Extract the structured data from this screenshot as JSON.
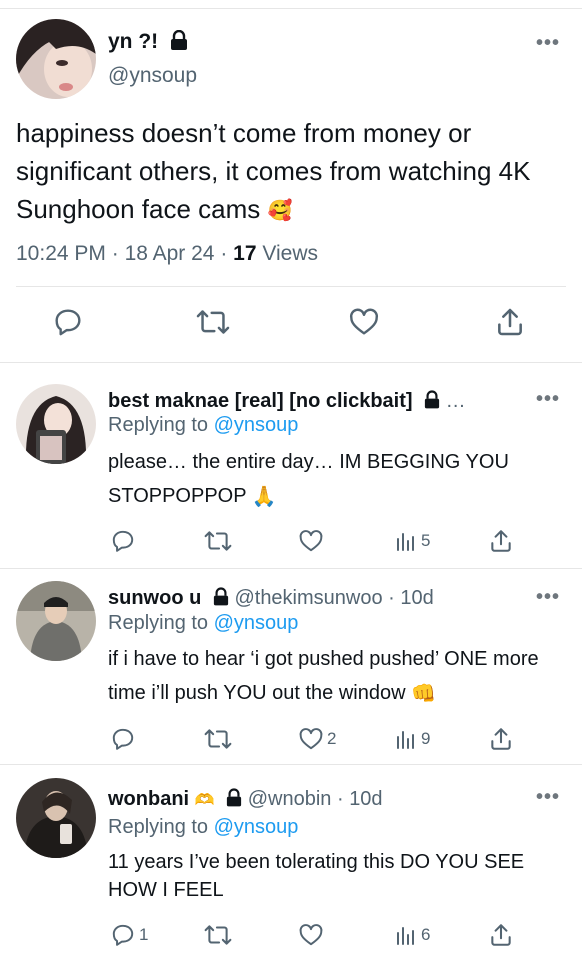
{
  "main_tweet": {
    "display_name": "yn ?!",
    "handle": "@ynsoup",
    "text": "happiness doesn’t come from money or significant others, it comes from watching 4K Sunghoon face cams",
    "emoji": "🥰",
    "time": "10:24 PM",
    "date": "18 Apr 24",
    "views_count": "17",
    "views_label": "Views",
    "more": "•••"
  },
  "replies": [
    {
      "display_name": "best maknae [real] [no clickbait]",
      "handle": "",
      "age": "",
      "replying_prefix": "Replying to",
      "replying_to": "@ynsoup",
      "text": "please… the entire day… IM BEGGING YOU STOPPOPPOP",
      "emoji": "🙏",
      "reply_count": "",
      "like_count": "",
      "views": "5",
      "more": "•••"
    },
    {
      "display_name": "sunwoo u",
      "handle": "@thekimsunwoo",
      "age": "10d",
      "replying_prefix": "Replying to",
      "replying_to": "@ynsoup",
      "text": "if i have to hear ‘i got pushed pushed’ ONE more time i’ll push YOU out the window",
      "emoji": "👊",
      "reply_count": "",
      "like_count": "2",
      "views": "9",
      "more": "•••"
    },
    {
      "display_name": "wonbani",
      "name_emoji": "🫶",
      "handle": "@wnobin",
      "age": "10d",
      "replying_prefix": "Replying to",
      "replying_to": "@ynsoup",
      "text": "11 years I’ve been tolerating this DO YOU SEE HOW I FEEL",
      "emoji": "",
      "reply_count": "1",
      "like_count": "",
      "views": "6",
      "more": "•••"
    }
  ],
  "icons": [
    "reply-icon",
    "retweet-icon",
    "like-icon",
    "views-icon",
    "share-icon",
    "lock-icon",
    "more-icon"
  ],
  "colors": {
    "text": "#0f1419",
    "secondary": "#536471",
    "link": "#1d9bf0",
    "divider": "#e6e6e6"
  }
}
